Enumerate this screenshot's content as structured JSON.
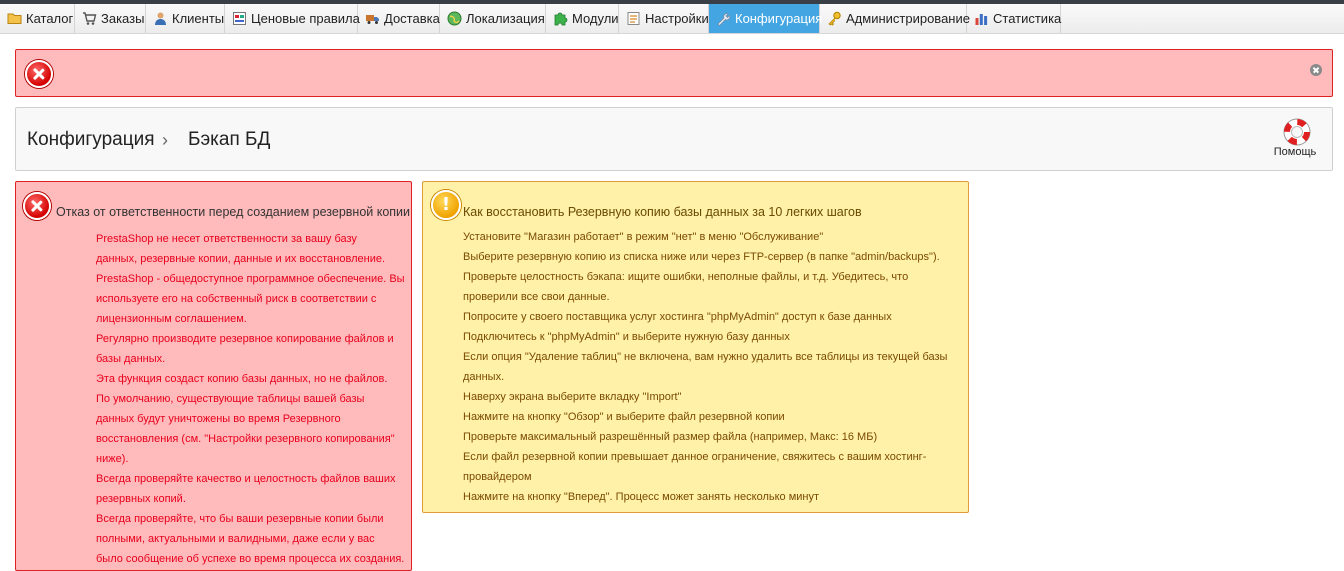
{
  "nav": {
    "tabs": [
      {
        "label": "Каталог",
        "icon": "folder-icon"
      },
      {
        "label": "Заказы",
        "icon": "cart-icon"
      },
      {
        "label": "Клиенты",
        "icon": "user-icon"
      },
      {
        "label": "Ценовые правила",
        "icon": "price-rules-icon"
      },
      {
        "label": "Доставка",
        "icon": "truck-icon"
      },
      {
        "label": "Локализация",
        "icon": "globe-icon"
      },
      {
        "label": "Модули",
        "icon": "puzzle-icon"
      },
      {
        "label": "Настройки",
        "icon": "settings-sheet-icon"
      },
      {
        "label": "Конфигурация",
        "icon": "wrench-icon",
        "active": true
      },
      {
        "label": "Администрирование",
        "icon": "key-icon"
      },
      {
        "label": "Статистика",
        "icon": "bar-chart-icon"
      }
    ]
  },
  "breadcrumb": {
    "root": "Конфигурация",
    "separator": "›",
    "page": "Бэкап БД"
  },
  "help": {
    "label": "Помощь"
  },
  "disclaimer": {
    "title": "Отказ от ответственности перед созданием резервной копии",
    "lines": [
      "PrestaShop не несет ответственности за вашу базу",
      "данных, резервные копии, данные и их восстановление.",
      "PrestaShop - общедоступное программное обеспечение. Вы",
      "используете его на собственный риск в соответствии с",
      "лицензионным соглашением.",
      "Регулярно производите резервное копирование файлов и",
      "базы данных.",
      "Эта функция создаст копию базы данных, но не файлов.",
      "По умолчанию, существующие таблицы вашей базы",
      "данных будут уничтожены во время Резервного",
      "восстановления (см. \"Настройки резервного копирования\"",
      "ниже).",
      "Всегда проверяйте качество и целостность файлов ваших",
      "резервных копий.",
      "Всегда проверяйте, что бы ваши резервные копии были",
      "полными, актуальными и валидными, даже если у вас",
      "было сообщение об успехе во время процесса их создания."
    ]
  },
  "howto": {
    "title": "Как восстановить Резервную копию базы данных за 10 легких шагов",
    "lines": [
      "Установите \"Магазин работает\" в режим \"нет\" в меню \"Обслуживание\"",
      "Выберите резервную копию из списка ниже или через FTP-сервер (в папке \"admin/backups\").",
      "Проверьте целостность бэкапа: ищите ошибки, неполные файлы, и т.д. Убедитесь, что",
      "проверили все свои данные.",
      "Попросите у своего поставщика услуг хостинга \"phpMyAdmin\" доступ к базе данных",
      "Подключитесь к \"phpMyAdmin\" и выберите нужную базу данных",
      "Если опция \"Удаление таблиц\" не включена, вам нужно удалить все таблицы из текущей базы",
      "данных.",
      "Наверху экрана выберите вкладку \"Import\"",
      "Нажмите на кнопку \"Обзор\" и выберите файл резервной копии",
      "Проверьте максимальный разрешённый размер файла (например, Макс: 16 МБ)",
      "Если файл резервной копии превышает данное ограничение, свяжитесь с вашим хостинг-",
      "провайдером",
      "Нажмите на кнопку \"Вперед\". Процесс может занять несколько минут"
    ]
  },
  "colors": {
    "active_tab": "#43a6e3",
    "error_bg": "#ffbabb",
    "error_border": "#dd2222",
    "warning_bg": "#fff1a8",
    "warning_border": "#e39b3a"
  }
}
